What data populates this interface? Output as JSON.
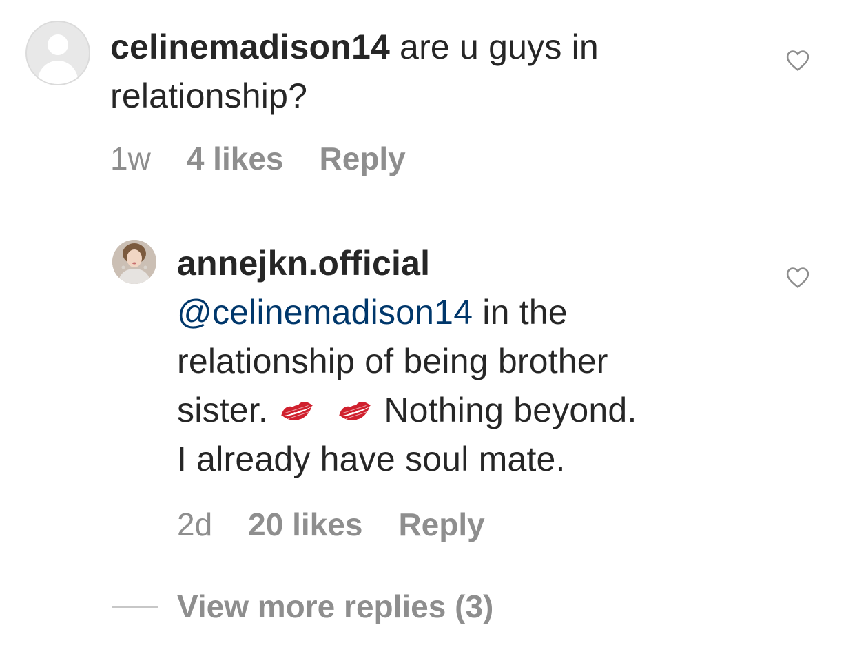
{
  "comment": {
    "username": "celinemadison14",
    "text_line1": " are u guys in",
    "text_line2": "relationship?",
    "time": "1w",
    "likes": "4 likes",
    "reply_label": "Reply"
  },
  "reply": {
    "username": "annejkn.official",
    "mention": "@celinemadison14",
    "text_after_mention": " in the",
    "line2": "relationship of being brother",
    "line3_start": "sister. ",
    "line3_end": " Nothing beyond.",
    "line4": "I already have soul mate.",
    "time": "2d",
    "likes": "20 likes",
    "reply_label": "Reply"
  },
  "view_more": "View more replies (3)",
  "icons": {
    "like": "heart-outline-icon",
    "emoji": "kiss-mark-emoji"
  },
  "colors": {
    "text": "#262626",
    "muted": "#8e8e8e",
    "mention": "#00376b",
    "kiss": "#d0202e"
  }
}
